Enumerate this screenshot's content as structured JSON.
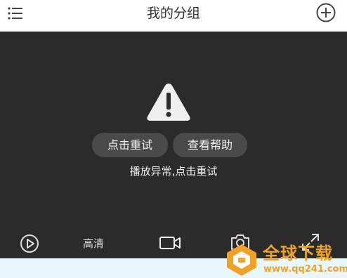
{
  "header": {
    "title": "我的分组",
    "menu_icon": "menu-icon",
    "add_icon": "add-circle-icon"
  },
  "player": {
    "warning_icon": "warning-triangle-icon",
    "retry_label": "点击重试",
    "help_label": "查看帮助",
    "error_message": "播放异常,点击重试"
  },
  "controls": {
    "play_icon": "play-icon",
    "quality_label": "高清",
    "record_icon": "video-record-icon",
    "snapshot_icon": "camera-icon",
    "fullscreen_icon": "expand-icon"
  },
  "watermark": {
    "logo_text": "全球下载",
    "url": "www.qq241.com",
    "color": "#f0a226"
  },
  "colors": {
    "player_bg": "#2b2b2b",
    "button_bg": "#4a4a4a",
    "below_bg": "#e9f6fb"
  }
}
